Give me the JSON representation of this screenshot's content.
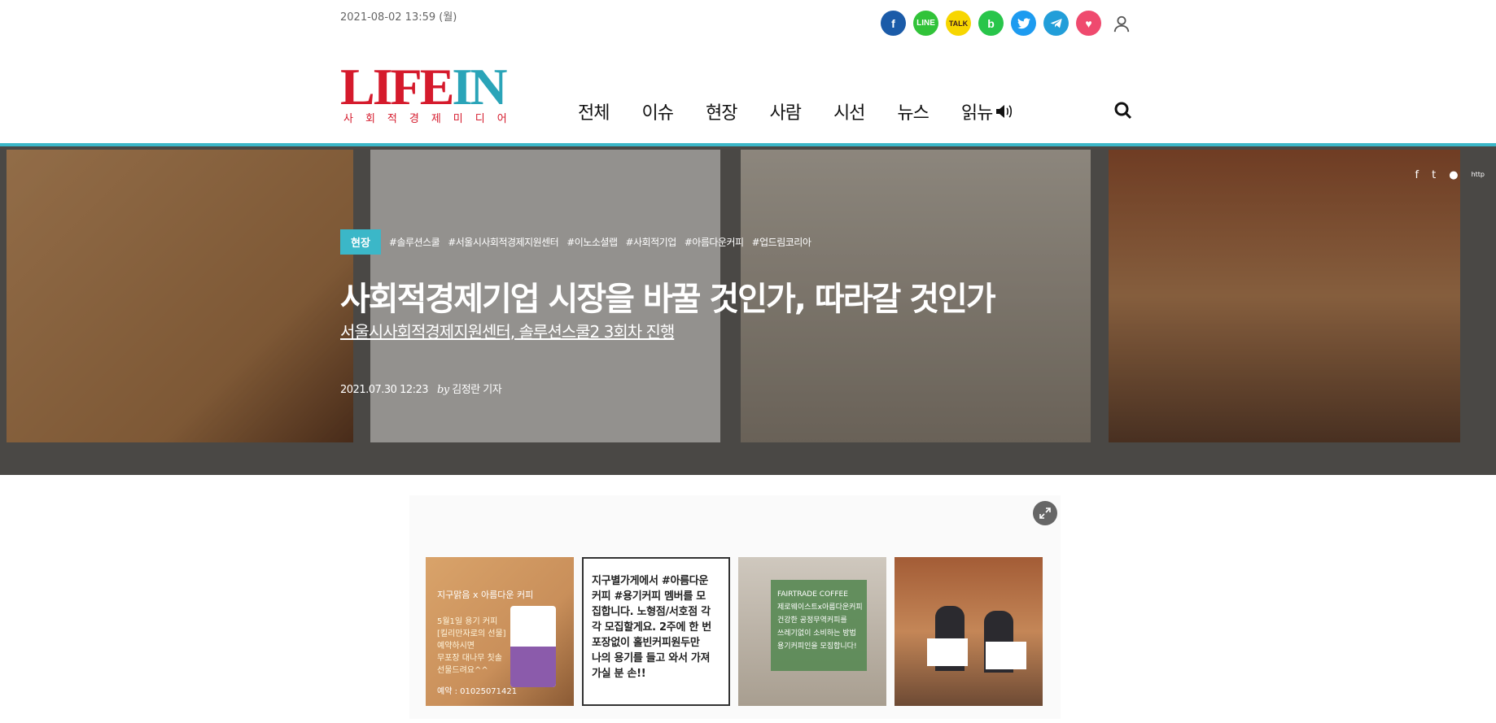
{
  "header": {
    "date": "2021-08-02 13:59 (월)",
    "logo": {
      "part1": "LIFE",
      "part2": "IN",
      "subtitle": "사회적경제미디어"
    },
    "nav": [
      "전체",
      "이슈",
      "현장",
      "사람",
      "시선",
      "뉴스",
      "읽뉴"
    ],
    "share_icons": [
      {
        "name": "facebook-icon",
        "color": "#1b5ba8",
        "glyph": "f"
      },
      {
        "name": "line-icon",
        "color": "#31c339",
        "glyph": "L"
      },
      {
        "name": "kakaotalk-icon",
        "color": "#f7d600",
        "glyph": "T"
      },
      {
        "name": "band-icon",
        "color": "#28c54a",
        "glyph": "b"
      },
      {
        "name": "twitter-icon",
        "color": "#1d9bf0",
        "glyph": "t"
      },
      {
        "name": "telegram-icon",
        "color": "#229ed9",
        "glyph": "➤"
      },
      {
        "name": "heart-icon",
        "color": "#ef4a6e",
        "glyph": "♥"
      }
    ]
  },
  "hero": {
    "category": "현장",
    "tags": [
      "#솔루션스쿨",
      "#서울시사회적경제지원센터",
      "#이노소셜랩",
      "#사회적기업",
      "#아름다운커피",
      "#업드림코리아"
    ],
    "headline": "사회적경제기업 시장을 바꿀 것인가, 따라갈 것인가",
    "subheadline": "서울시사회적경제지원센터, 솔루션스쿨2 3회차 진행",
    "datetime": "2021.07.30 12:23",
    "by": "by",
    "author": "김정란 기자",
    "social": [
      "f",
      "t",
      "●",
      "http"
    ]
  },
  "gallery": {
    "thumb1": {
      "title": "지구맑음 x 아름다운 커피",
      "body": "5월1일 용기 커피\n[킬리만자로의 선물]\n예약하시면\n무포장 대나무 칫솔\n선물드려요^^",
      "contact": "예약 : 01025071421"
    },
    "thumb2": {
      "text": "지구별가게에서 #아름다운\n커피 #용기커피 멤버를 모\n집합니다. 노형점/서호점 각\n각 모집할게요. 2주에 한 번\n포장없이 홀빈커피원두만\n나의 용기를 들고 와서 가져\n가실 분 손!!"
    },
    "thumb3": {
      "text": "FAIRTRADE COFFEE\n제로웨이스트x아름다운커피\n건강한 공정무역커피를\n쓰레기없이 소비하는 방법\n용기커피인을 모집합니다!"
    }
  },
  "colors": {
    "accent": "#3bb7c8",
    "brand_red": "#d51a2c"
  }
}
